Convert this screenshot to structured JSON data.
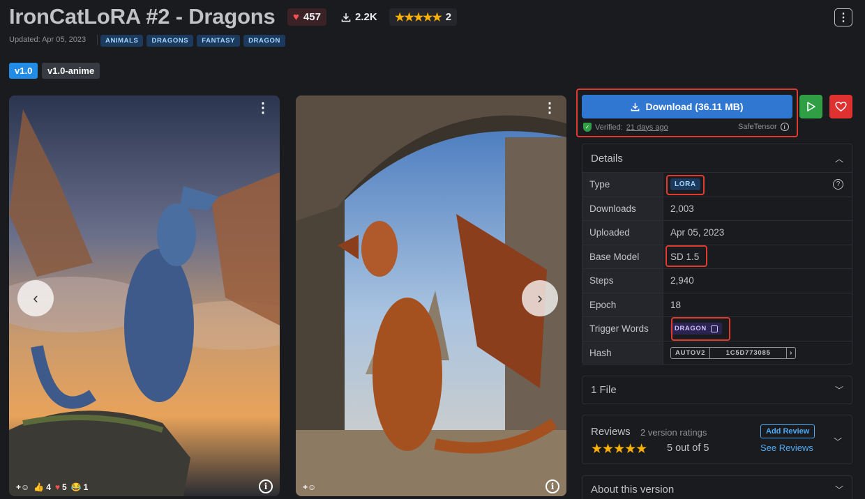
{
  "header": {
    "title": "IronCatLoRA #2 - Dragons",
    "likes": "457",
    "downloads": "2.2K",
    "rating_count": "2",
    "updated": "Updated: Apr 05, 2023",
    "tags": [
      "ANIMALS",
      "DRAGONS",
      "FANTASY",
      "DRAGON"
    ]
  },
  "versions": {
    "active": "v1.0",
    "other": "v1.0-anime"
  },
  "gallery": {
    "left": {
      "reactions": {
        "thumbs": "4",
        "hearts": "5",
        "laugh": "1"
      }
    }
  },
  "sidebar": {
    "download_label": "Download (36.11 MB)",
    "verified_label": "Verified:",
    "verified_ago": "21 days ago",
    "safetensor": "SafeTensor",
    "details_title": "Details",
    "rows": {
      "type_k": "Type",
      "type_v": "LORA",
      "downloads_k": "Downloads",
      "downloads_v": "2,003",
      "uploaded_k": "Uploaded",
      "uploaded_v": "Apr 05, 2023",
      "base_k": "Base Model",
      "base_v": "SD 1.5",
      "steps_k": "Steps",
      "steps_v": "2,940",
      "epoch_k": "Epoch",
      "epoch_v": "18",
      "trigger_k": "Trigger Words",
      "trigger_v": "DRAGON",
      "hash_k": "Hash",
      "hash_type": "AUTOV2",
      "hash_value": "1C5D773085"
    },
    "files_title": "1 File",
    "reviews_title": "Reviews",
    "reviews_sub": "2 version ratings",
    "reviews_score": "5 out of 5",
    "add_review": "Add Review",
    "see_reviews": "See Reviews",
    "about_title": "About this version"
  },
  "colors": {
    "accent": "#228be6",
    "download": "#2f77d1",
    "play": "#2f9e44",
    "favorite": "#e03131",
    "highlight_box": "#e03a2f"
  }
}
